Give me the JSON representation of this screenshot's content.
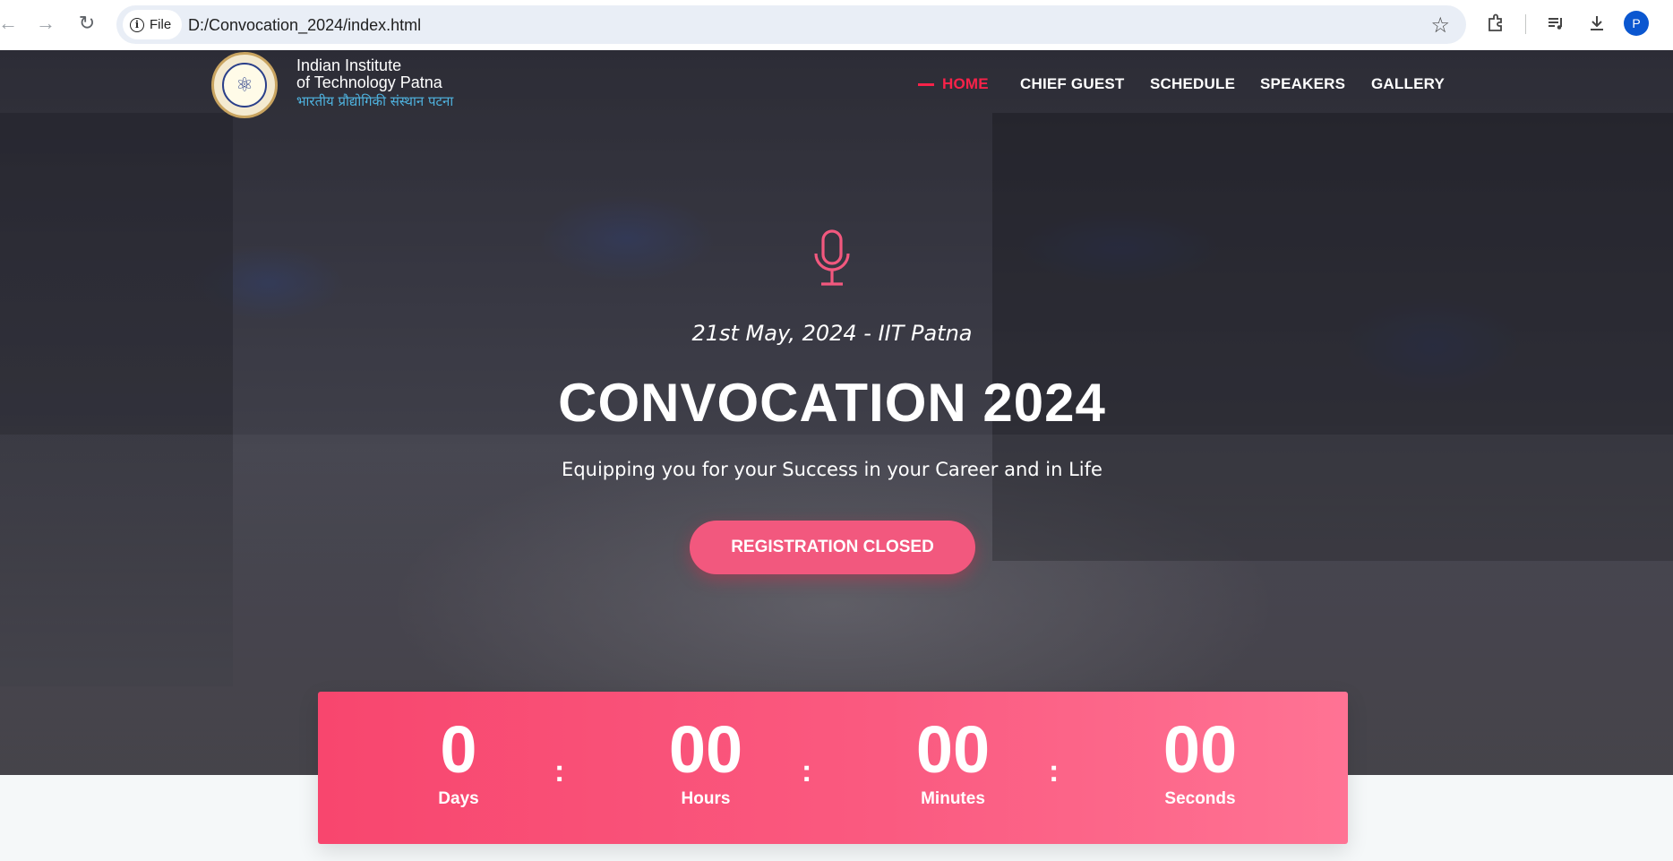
{
  "browser": {
    "site_chip": "File",
    "url": "D:/Convocation_2024/index.html",
    "profile_initial": "P"
  },
  "site": {
    "logo_line1": "Indian Institute",
    "logo_line2": "of Technology  Patna",
    "logo_line3": "भारतीय प्रौद्योगिकी संस्थान पटना"
  },
  "nav": {
    "items": [
      {
        "label": "HOME",
        "active": true
      },
      {
        "label": "CHIEF GUEST"
      },
      {
        "label": "SCHEDULE"
      },
      {
        "label": "SPEAKERS"
      },
      {
        "label": "GALLERY"
      }
    ]
  },
  "hero": {
    "date_line": "21st May, 2024 - IIT Patna",
    "title": "CONVOCATION 2024",
    "tagline": "Equipping you for your Success in your Career and in Life",
    "button_label": "REGISTRATION CLOSED",
    "icon": "microphone-icon"
  },
  "countdown": {
    "days": {
      "value": "0",
      "label": "Days"
    },
    "hours": {
      "value": "00",
      "label": "Hours"
    },
    "minutes": {
      "value": "00",
      "label": "Minutes"
    },
    "seconds": {
      "value": "00",
      "label": "Seconds"
    },
    "separator": ":"
  },
  "colors": {
    "accent": "#f82249",
    "countdown_start": "#f8466e",
    "countdown_end": "#ff7394",
    "button": "#f2587e",
    "logo_subtitle": "#4fb3e0"
  }
}
